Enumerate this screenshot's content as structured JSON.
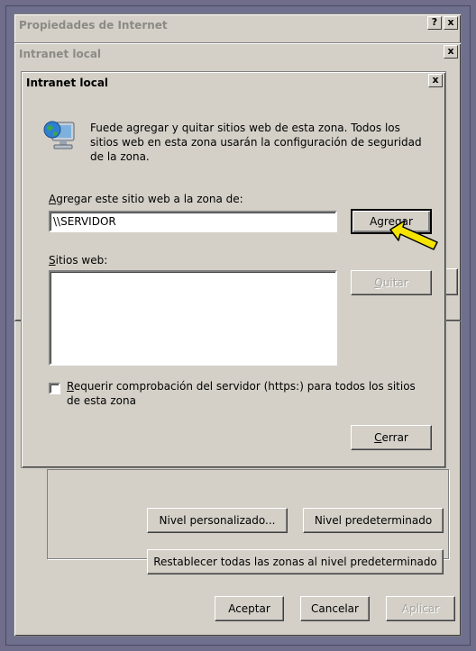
{
  "outer_window": {
    "title": "Propiedades de Internet",
    "help_button": "?",
    "close_button": "x",
    "buttons": {
      "custom_level": "Nivel personalizado...",
      "default_level": "Nivel predeterminado",
      "reset_all": "Restablecer todas las zonas al nivel predeterminado",
      "ok": "Aceptar",
      "cancel": "Cancelar",
      "apply": "Aplicar"
    }
  },
  "middle_window": {
    "title": "Intranet local",
    "close_button": "x"
  },
  "dialog": {
    "title": "Intranet local",
    "close_button": "x",
    "icon": "computer-globe-icon",
    "description": "Fuede agregar y quitar sitios web de esta zona. Todos los sitios web en esta zona usarán la configuración de seguridad de la zona.",
    "add_label_pre": "A",
    "add_label_post": "gregar este sitio web a la zona de:",
    "add_input_value": "\\\\SERVIDOR",
    "add_button_pre": "Agre",
    "add_button_u": "g",
    "add_button_post": "ar",
    "sites_label_pre": "S",
    "sites_label_post": "itios web:",
    "sites_list": [],
    "remove_button_pre": "Q",
    "remove_button_post": "uitar",
    "https_checkbox_checked": false,
    "https_label_line1_pre": "R",
    "https_label_line1_post": "equerir comprobación del servidor (https:) para todos los sitios",
    "https_label_line2": "de esta zona",
    "close_btn_pre": "C",
    "close_btn_post": "errar"
  },
  "annotation": {
    "arrow_color": "#f5e400",
    "arrow_outline": "#000000"
  }
}
